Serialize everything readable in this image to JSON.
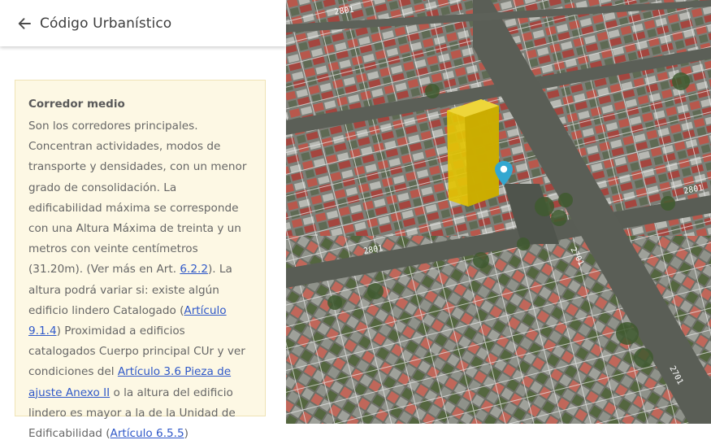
{
  "header": {
    "title": "Código Urbanístico"
  },
  "card": {
    "title": "Corredor medio",
    "text_1": "Son los corredores principales. Concentran actividades, modos de transporte y densidades, con un menor grado de consolidación. La edificabilidad máxima se corresponde con una Altura Máxima de treinta y un metros con veinte centímetros (31.20m). (Ver más en Art. ",
    "link_1": "6.2.2",
    "text_2": "). La altura podrá variar si: existe algún edificio lindero Catalogado (",
    "link_2": "Artículo 9.1.4",
    "text_3": ") Proximidad a edificios catalogados Cuerpo principal CUr y ver condiciones del ",
    "link_3": "Artículo 3.6 Pieza de ajuste Anexo II",
    "text_4": " o la altura del edificio lindero es mayor a la de la Unidad de Edificabilidad (",
    "link_4": "Artículo 6.5.5",
    "text_5": ")"
  },
  "map": {
    "street_labels": [
      "2801",
      "2801",
      "2801",
      "2701",
      "2701"
    ],
    "building_color": "#e2c305",
    "marker_color": "#33a7d0"
  },
  "icons": {
    "back": "arrow-left-icon",
    "marker": "map-pin-icon"
  }
}
